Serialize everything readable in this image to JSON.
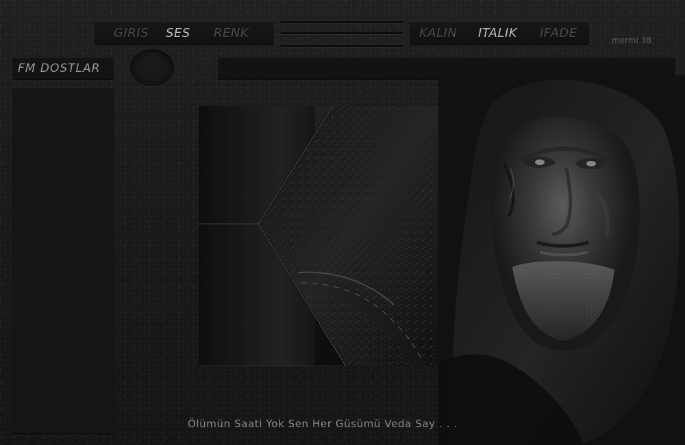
{
  "header": {
    "left_nav": [
      "GIRIS",
      "SES",
      "RENK"
    ],
    "right_nav": [
      "KALIN",
      "ITALIK",
      "IFADE"
    ],
    "counter": "mermi 38"
  },
  "sidebar": {
    "title": "FM DOSTLAR"
  },
  "caption": "Ölümün  Saati  Yok  Sen  Her  Güsümü  Veda  Say . . .",
  "colors": {
    "background": "#1a1a1a",
    "panel": "#131313",
    "text_dim": "#4a4a4a",
    "text_bright": "#bdbdbd"
  }
}
